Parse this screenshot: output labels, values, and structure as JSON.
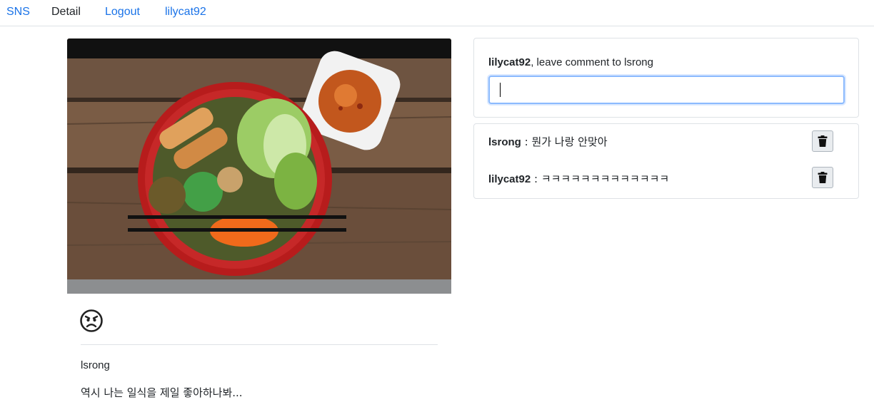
{
  "nav": {
    "brand": "SNS",
    "items": [
      {
        "label": "Detail",
        "active": true
      },
      {
        "label": "Logout",
        "active": false
      },
      {
        "label": "lilycat92",
        "active": false
      }
    ]
  },
  "post": {
    "image_alt": "Bowl of Vietnamese noodle salad with spring rolls and dipping sauce",
    "mood_icon": "angry-face-icon",
    "author": "lsrong",
    "text": "역시 나는 일식을 제일 좋아하나봐..."
  },
  "comment_form": {
    "user": "lilycat92",
    "prompt_suffix": ", leave comment to lsrong",
    "input_value": "",
    "input_placeholder": ""
  },
  "comments": [
    {
      "author": "lsrong",
      "separator": " : ",
      "text": "뭔가 나랑 안맞아",
      "delete_icon": "trash-icon"
    },
    {
      "author": "lilycat92",
      "separator": " : ",
      "text": "ㅋㅋㅋㅋㅋㅋㅋㅋㅋㅋㅋㅋㅋ",
      "delete_icon": "trash-icon"
    }
  ],
  "colors": {
    "link": "#1a73e8",
    "border": "#dee2e6",
    "focus": "#8bbafe"
  }
}
